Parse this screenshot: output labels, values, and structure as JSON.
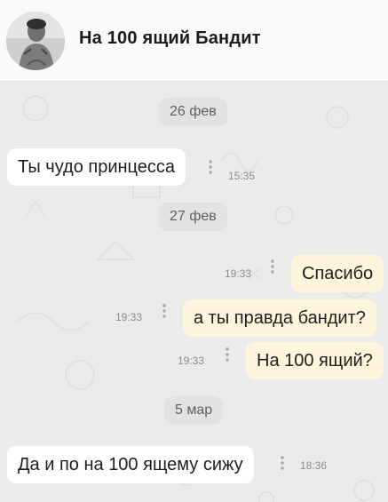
{
  "header": {
    "title": "На 100 ящий Бандит",
    "avatar_icon": "avatar-photo"
  },
  "messages": [
    {
      "type": "date",
      "text": "26 фев"
    },
    {
      "type": "in",
      "text": "Ты чудо принцесса",
      "time": "15:35"
    },
    {
      "type": "date",
      "text": "27 фев"
    },
    {
      "type": "out",
      "text": "Спасибо",
      "time": "19:33"
    },
    {
      "type": "out",
      "text": "а ты правда бандит?",
      "time": "19:33"
    },
    {
      "type": "out",
      "text": "На 100 ящий?",
      "time": "19:33"
    },
    {
      "type": "date",
      "text": "5 мар"
    },
    {
      "type": "in",
      "text": "Да и по на 100 ящему сижу",
      "time": "18:36"
    }
  ],
  "icons": {
    "menu": "vertical-dots-icon"
  }
}
